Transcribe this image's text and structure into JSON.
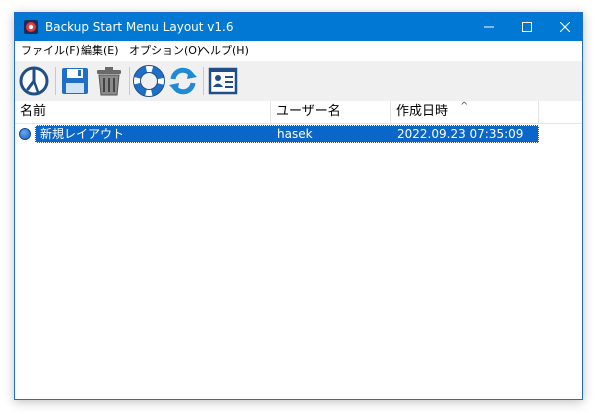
{
  "window": {
    "title": "Backup Start Menu Layout v1.6",
    "accent": "#0078d4"
  },
  "menu": [
    {
      "label": "ファイル(F)"
    },
    {
      "label": "編集(E)"
    },
    {
      "label": "オプション(O)"
    },
    {
      "label": "ヘルプ(H)"
    }
  ],
  "toolbar": {
    "icons": [
      "backup-clock-icon",
      "save-icon",
      "trash-icon",
      "lifebuoy-icon",
      "refresh-icon",
      "id-card-icon"
    ]
  },
  "list": {
    "columns": [
      "名前",
      "ユーザー名",
      "作成日時"
    ],
    "sort_indicator": "^",
    "rows": [
      {
        "name": "新規レイアウト",
        "user": "hasek",
        "created": "2022.09.23 07:35:09",
        "selected": true
      }
    ],
    "selection_color": "#0a66c8"
  }
}
